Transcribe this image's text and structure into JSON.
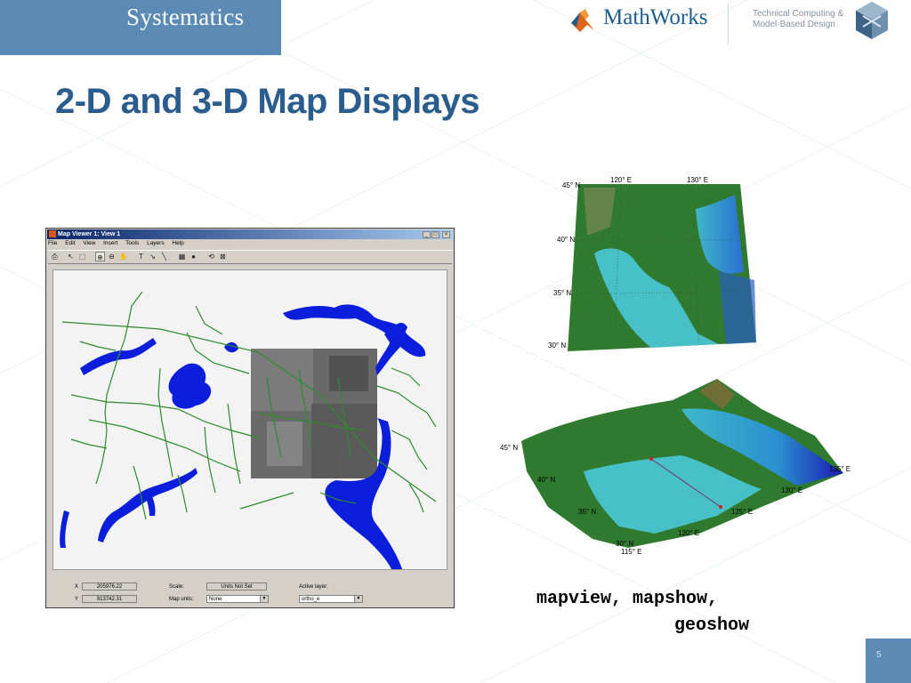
{
  "header": {
    "brand": "Systematics",
    "mathworks": "MathWorks",
    "tagline_line1": "Technical Computing &",
    "tagline_line2": "Model-Based Design"
  },
  "slide": {
    "title": "2-D and 3-D Map Displays",
    "commands_line1": "mapview, mapshow,",
    "commands_line2": "geoshow",
    "page_number": "5"
  },
  "map_viewer": {
    "window_title": "Map Viewer 1: View 1",
    "menu": [
      "File",
      "Edit",
      "View",
      "Insert",
      "Tools",
      "Layers",
      "Help"
    ],
    "status": {
      "x_label": "X",
      "x_value": "205976.22",
      "y_label": "Y",
      "y_value": "913742.31",
      "scale_label": "Scale:",
      "scale_value": "Units Not Set",
      "map_units_label": "Map units:",
      "map_units_value": "None",
      "active_layer_label": "Active layer:",
      "active_layer_value": "ortho_e"
    }
  },
  "map2d": {
    "lon_labels": [
      "120° E",
      "130° E"
    ],
    "lat_labels": [
      "45° N",
      "40° N",
      "35° N",
      "30° N"
    ]
  },
  "map3d": {
    "lat_labels": [
      "45° N",
      "40° N",
      "35° N",
      "30° N"
    ],
    "lon_labels": [
      "115° E",
      "120° E",
      "125° E",
      "130° E",
      "135° E"
    ]
  },
  "colors": {
    "brand_blue": "#5b8bb5",
    "title_blue": "#2b5c8e",
    "water": "#0a1edc",
    "roads": "#2e8b2e"
  }
}
